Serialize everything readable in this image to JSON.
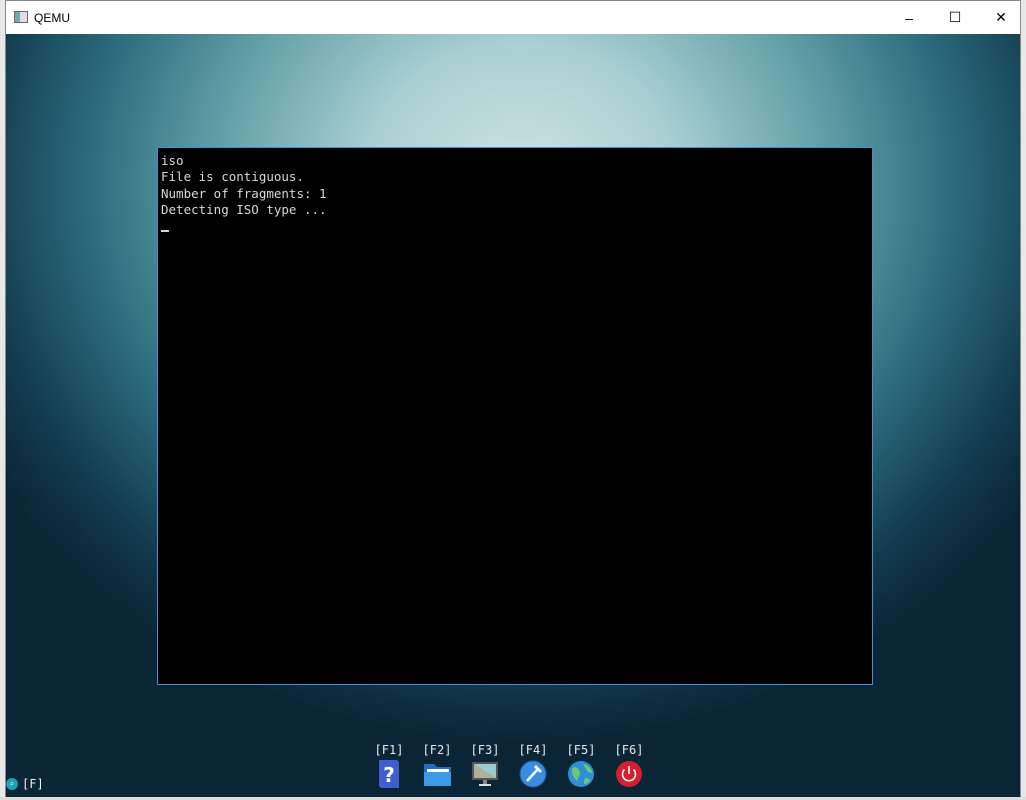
{
  "window": {
    "title": "QEMU",
    "minimize": "–",
    "maximize": "☐",
    "close": "✕"
  },
  "terminal": {
    "lines": [
      "iso",
      "File is contiguous.",
      "Number of fragments: 1",
      "Detecting ISO type ..."
    ]
  },
  "dock": [
    {
      "key": "[F1]",
      "icon": "help-icon"
    },
    {
      "key": "[F2]",
      "icon": "folder-icon"
    },
    {
      "key": "[F3]",
      "icon": "monitor-icon"
    },
    {
      "key": "[F4]",
      "icon": "hammer-icon"
    },
    {
      "key": "[F5]",
      "icon": "globe-icon"
    },
    {
      "key": "[F6]",
      "icon": "power-icon"
    }
  ],
  "status": {
    "label": "[F]"
  },
  "colors": {
    "terminal_border": "#4a8ae0",
    "power": "#d4202c",
    "globe": "#2e8fd8"
  }
}
